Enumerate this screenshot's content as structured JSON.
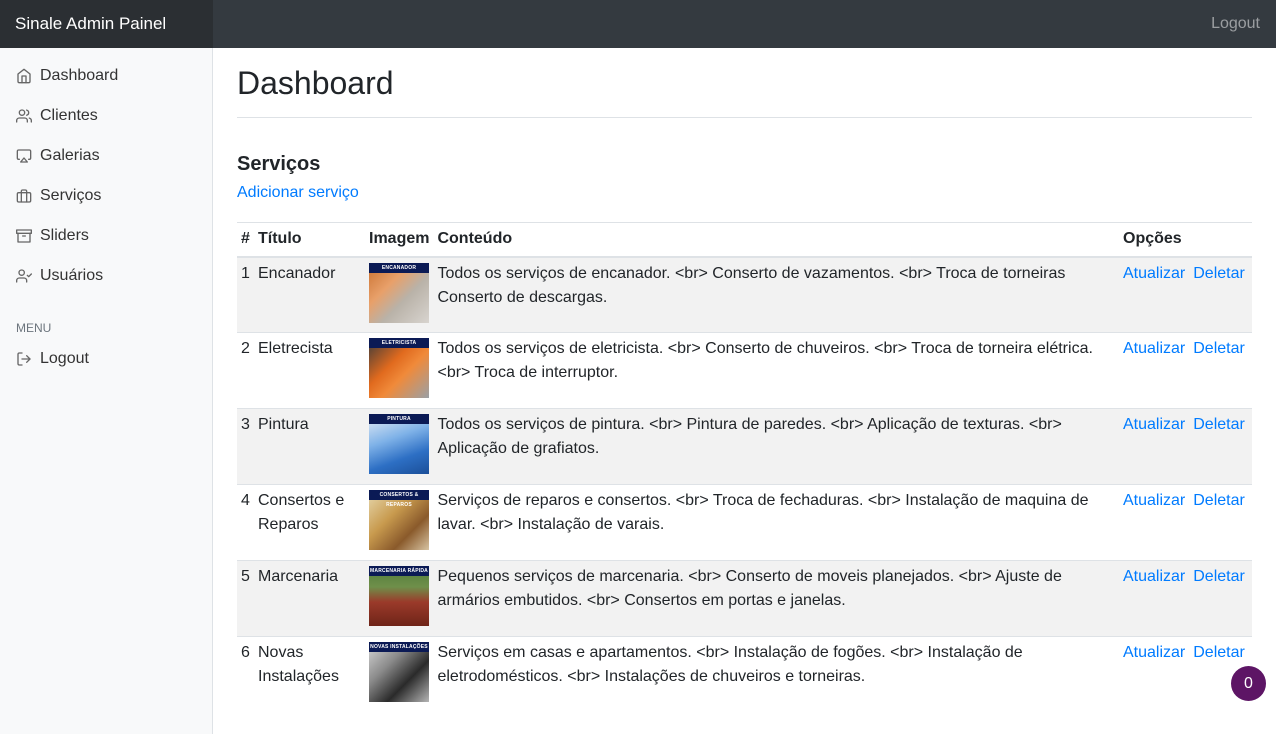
{
  "header": {
    "brand": "Sinale Admin Painel",
    "logout": "Logout"
  },
  "sidebar": {
    "items": [
      {
        "label": "Dashboard",
        "icon": "home-icon"
      },
      {
        "label": "Clientes",
        "icon": "users-icon"
      },
      {
        "label": "Galerias",
        "icon": "airplay-icon"
      },
      {
        "label": "Serviços",
        "icon": "briefcase-icon"
      },
      {
        "label": "Sliders",
        "icon": "archive-icon"
      },
      {
        "label": "Usuários",
        "icon": "user-check-icon"
      }
    ],
    "menu_heading": "MENU",
    "menu_items": [
      {
        "label": "Logout",
        "icon": "log-out-icon"
      }
    ]
  },
  "main": {
    "title": "Dashboard",
    "section_title": "Serviços",
    "add_link": "Adicionar serviço",
    "table": {
      "headers": [
        "#",
        "Título",
        "Imagem",
        "Conteúdo",
        "Opções"
      ],
      "rows": [
        {
          "num": "1",
          "title": "Encanador",
          "image_label": "ENCANADOR",
          "content": "Todos os serviços de encanador. <br> Conserto de vazamentos. <br> Troca de torneiras Conserto de descargas.",
          "update": "Atualizar",
          "delete": "Deletar"
        },
        {
          "num": "2",
          "title": "Eletrecista",
          "image_label": "ELETRICISTA",
          "content": "Todos os serviços de eletricista. <br> Conserto de chuveiros. <br> Troca de torneira elétrica. <br> Troca de interruptor.",
          "update": "Atualizar",
          "delete": "Deletar"
        },
        {
          "num": "3",
          "title": "Pintura",
          "image_label": "PINTURA",
          "content": "Todos os serviços de pintura. <br> Pintura de paredes. <br> Aplicação de texturas. <br> Aplicação de grafiatos.",
          "update": "Atualizar",
          "delete": "Deletar"
        },
        {
          "num": "4",
          "title": "Consertos e Reparos",
          "image_label": "CONSERTOS & REPAROS",
          "content": "Serviços de reparos e consertos. <br> Troca de fechaduras. <br> Instalação de maquina de lavar. <br> Instalação de varais.",
          "update": "Atualizar",
          "delete": "Deletar"
        },
        {
          "num": "5",
          "title": "Marcenaria",
          "image_label": "MARCENARIA RÁPIDA",
          "content": "Pequenos serviços de marcenaria. <br> Conserto de moveis planejados. <br> Ajuste de armários embutidos. <br> Consertos em portas e janelas.",
          "update": "Atualizar",
          "delete": "Deletar"
        },
        {
          "num": "6",
          "title": "Novas Instalações",
          "image_label": "NOVAS INSTALAÇÕES",
          "content": "Serviços em casas e apartamentos. <br> Instalação de fogões. <br> Instalação de eletrodomésticos. <br> Instalações de chuveiros e torneiras.",
          "update": "Atualizar",
          "delete": "Deletar"
        }
      ]
    }
  },
  "badge": {
    "count": "0"
  },
  "colors": {
    "topbar": "#343a40",
    "brand_bg": "#2b2f33",
    "sidebar_bg": "#f8f9fa",
    "link": "#007bff",
    "badge": "#5d1565"
  }
}
